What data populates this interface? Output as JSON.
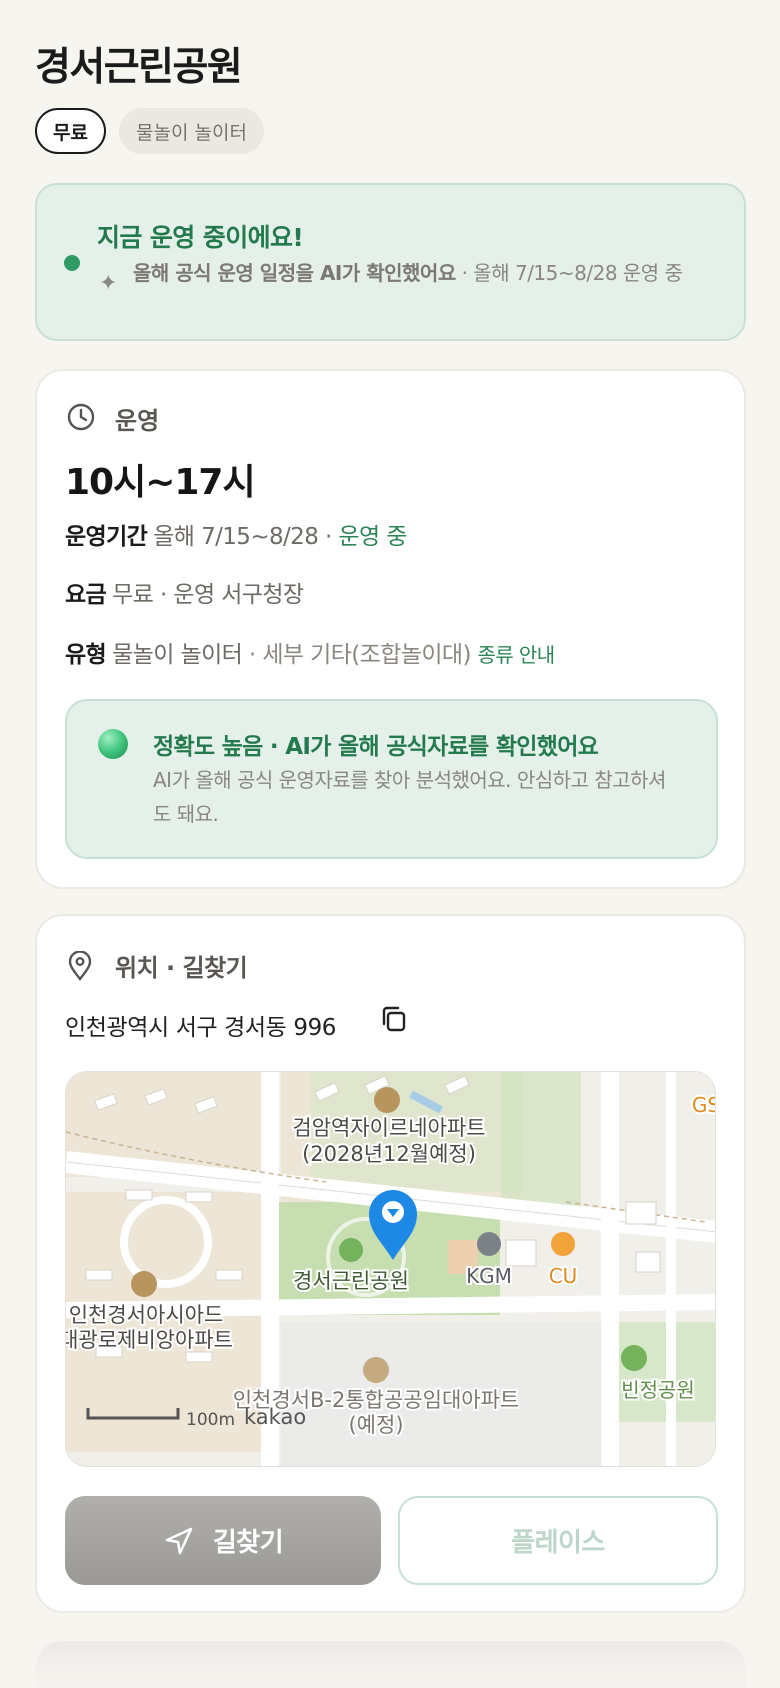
{
  "header": {
    "title": "경서근린공원",
    "chips": [
      "무료",
      "물놀이 놀이터"
    ]
  },
  "status": {
    "title": "지금 운영 중이에요!",
    "ai_note": "올해 공식 운영 일정을 AI가 확인했어요",
    "ai_note_suffix": " · 올해 7/15~8/28 운영 중"
  },
  "operation": {
    "section_label": "운영",
    "hours": "10시~17시",
    "period_key": "운영기간",
    "period_value": "올해 7/15~8/28 · ",
    "period_status": "운영 중",
    "fee_key": "요금",
    "fee_value": "무료 · 운영 서구청장",
    "type_key": "유형",
    "type_value": "물놀이 놀이터",
    "type_detail": " · 세부 기타(조합놀이대) ",
    "type_link": "종류 안내",
    "accuracy_title": "정확도 높음 · AI가 올해 공식자료를 확인했어요",
    "accuracy_text": "AI가 올해 공식 운영자료를 찾아 분석했어요. 안심하고 참고하셔도 돼요."
  },
  "location": {
    "section_label": "위치 · 길찾기",
    "address": "인천광역시 서구 경서동 996",
    "map": {
      "labels": {
        "apt_top_1": "검암역자이르네아파트",
        "apt_top_2": "(2028년12월예정)",
        "park": "경서근린공원",
        "kgm": "KGM",
        "cu": "CU",
        "gs": "GS",
        "apt_left_1": "인천경서아시아드",
        "apt_left_2": "대광로제비앙아파트",
        "apt_bottom_1": "인천경서B-2통합공공임대아파트",
        "apt_bottom_2": "(예정)",
        "park_right": "빈정공원",
        "scale": "100m",
        "brand": "kakao"
      }
    },
    "route_button": "길찾기",
    "place_button": "플레이스"
  },
  "colors": {
    "accent_green": "#2c8556",
    "status_bg": "#e5f0ea",
    "pin_blue": "#1e88e5"
  }
}
